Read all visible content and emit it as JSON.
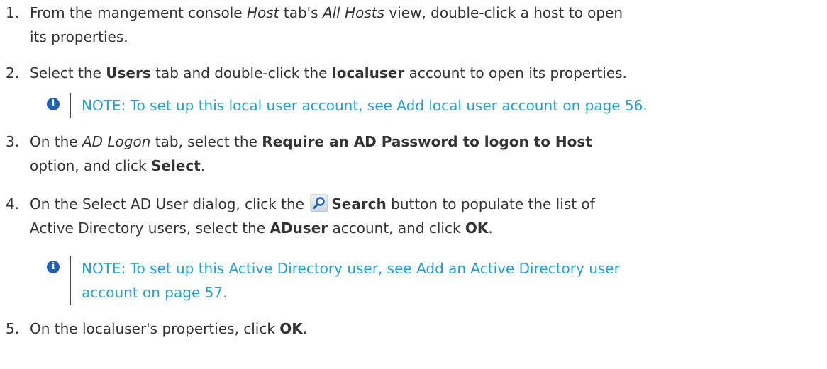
{
  "steps": [
    {
      "number": "1.",
      "line1_a": "From the mangement console ",
      "line1_host": "Host",
      "line1_b": " tab's ",
      "line1_allhosts": "All Hosts",
      "line1_c": " view, double-click a host to open",
      "line2": "its properties."
    },
    {
      "number": "2.",
      "a": "Select the ",
      "users": "Users",
      "b": " tab and double-click the ",
      "localuser": "localuser",
      "c": " account to open its properties."
    },
    {
      "number": "3.",
      "a": "On the ",
      "adlogon": "AD Logon",
      "b": " tab, select the ",
      "option": "Require an AD Password to logon to Host",
      "c": "option, and click ",
      "select": "Select",
      "d": "."
    },
    {
      "number": "4.",
      "a": "On the Select AD User dialog, click the ",
      "search": "Search",
      "b": " button to populate the list of",
      "c": "Active Directory users, select the ",
      "aduser": "ADuser",
      "d": " account, and click ",
      "ok": "OK",
      "e": "."
    },
    {
      "number": "5.",
      "a": "On the localuser's properties, click ",
      "ok": "OK",
      "b": "."
    }
  ],
  "notes": [
    {
      "prefix": "NOTE: To set up this local user account, see ",
      "link": "Add local user account on page 56",
      "suffix": "."
    },
    {
      "prefix": "NOTE: To set up this Active Directory user, see ",
      "link_line1": "Add an Active Directory user",
      "link_line2": "account on page 57",
      "suffix": "."
    }
  ],
  "colors": {
    "text": "#333333",
    "note": "#21a0d2",
    "info_icon": "#1f5fb9"
  },
  "icons": {
    "info": "info-icon",
    "search": "search-icon"
  }
}
